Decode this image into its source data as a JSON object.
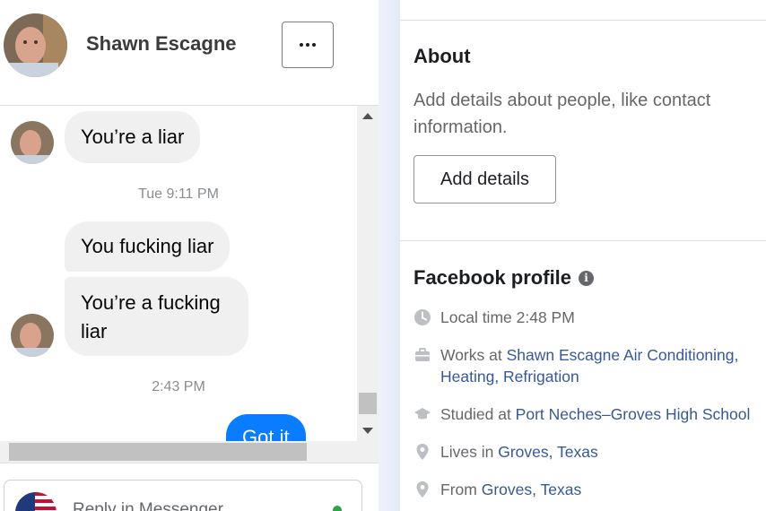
{
  "chat": {
    "contact_name": "Shawn Escagne",
    "messages": [
      {
        "text": "You’re a liar"
      },
      {
        "timestamp": "Tue 9:11 PM"
      },
      {
        "text": "You fucking liar"
      },
      {
        "text_line1": "You’re a fucking",
        "text_line2": "liar"
      },
      {
        "timestamp": "2:43 PM"
      },
      {
        "text": "Got it"
      }
    ],
    "reply_placeholder": "Reply in Messenger"
  },
  "profile": {
    "about_title": "About",
    "about_desc": "Add details about people, like contact information.",
    "add_details_label": "Add details",
    "fb_profile_title": "Facebook profile",
    "local_time": "Local time 2:48 PM",
    "works_prefix": "Works at ",
    "works_link": "Shawn Escagne Air Conditioning, Heating, Refrigation",
    "studied_prefix": "Studied at ",
    "studied_link": "Port Neches–Groves High School",
    "lives_prefix": "Lives in ",
    "lives_link": "Groves, Texas",
    "from_prefix": "From ",
    "from_link": "Groves, Texas"
  },
  "colors": {
    "bubble_in": "#f0f0f0",
    "bubble_out": "#0a7cff",
    "link": "#385898",
    "muted": "#65676b",
    "online": "#31a24c"
  },
  "icons": [
    "more-icon",
    "clock-icon",
    "briefcase-icon",
    "graduation-cap-icon",
    "location-pin-icon",
    "info-icon"
  ]
}
